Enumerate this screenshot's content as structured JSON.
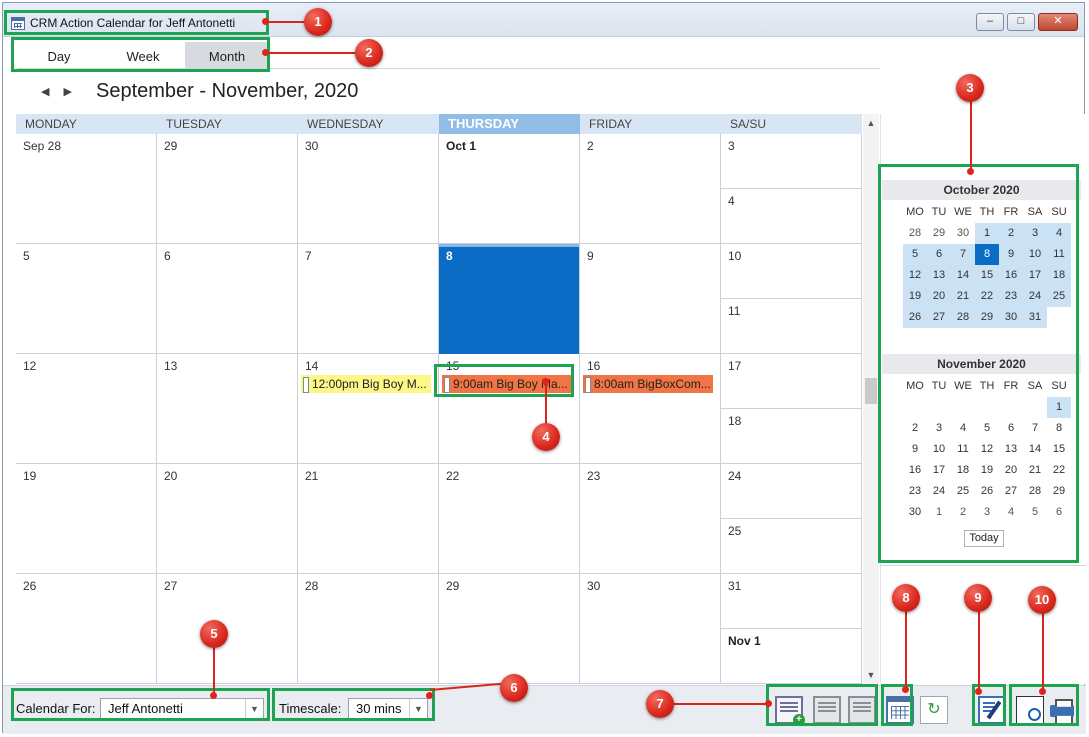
{
  "window": {
    "title": "CRM Action Calendar for Jeff Antonetti",
    "controls": [
      "–",
      "□",
      "✕"
    ]
  },
  "view_tabs": [
    {
      "label": "Day",
      "active": false
    },
    {
      "label": "Week",
      "active": false
    },
    {
      "label": "Month",
      "active": true
    }
  ],
  "range_title": "September - November, 2020",
  "days_header": [
    "MONDAY",
    "TUESDAY",
    "WEDNESDAY",
    "THURSDAY",
    "FRIDAY",
    "SA/SU"
  ],
  "weeks": [
    {
      "days": [
        "Sep 28",
        "29",
        "30",
        "Oct 1",
        "2"
      ],
      "sat": "3",
      "sun": "4"
    },
    {
      "days": [
        "5",
        "6",
        "7",
        "8",
        "9"
      ],
      "sat": "10",
      "sun": "11"
    },
    {
      "days": [
        "12",
        "13",
        "14",
        "15",
        "16"
      ],
      "sat": "17",
      "sun": "18"
    },
    {
      "days": [
        "19",
        "20",
        "21",
        "22",
        "23"
      ],
      "sat": "24",
      "sun": "25"
    },
    {
      "days": [
        "26",
        "27",
        "28",
        "29",
        "30"
      ],
      "sat": "31",
      "sun": "Nov 1"
    }
  ],
  "appointments": [
    {
      "text": "12:00pm Big Boy M...",
      "color": "#fcf888"
    },
    {
      "text": "9:00am Big Boy Ma...",
      "color": "#f07444"
    },
    {
      "text": "8:00am BigBoxCom...",
      "color": "#f07444"
    }
  ],
  "mini_calendar": {
    "dow": [
      "MO",
      "TU",
      "WE",
      "TH",
      "FR",
      "SA",
      "SU"
    ],
    "october": {
      "title": "October 2020",
      "rows": [
        [
          "28",
          "29",
          "30",
          "1",
          "2",
          "3",
          "4"
        ],
        [
          "5",
          "6",
          "7",
          "8",
          "9",
          "10",
          "11"
        ],
        [
          "12",
          "13",
          "14",
          "15",
          "16",
          "17",
          "18"
        ],
        [
          "19",
          "20",
          "21",
          "22",
          "23",
          "24",
          "25"
        ],
        [
          "26",
          "27",
          "28",
          "29",
          "30",
          "31",
          ""
        ]
      ]
    },
    "november": {
      "title": "November 2020",
      "rows": [
        [
          "",
          "",
          "",
          "",
          "",
          "",
          "1"
        ],
        [
          "2",
          "3",
          "4",
          "5",
          "6",
          "7",
          "8"
        ],
        [
          "9",
          "10",
          "11",
          "12",
          "13",
          "14",
          "15"
        ],
        [
          "16",
          "17",
          "18",
          "19",
          "20",
          "21",
          "22"
        ],
        [
          "23",
          "24",
          "25",
          "26",
          "27",
          "28",
          "29"
        ],
        [
          "30",
          "1",
          "2",
          "3",
          "4",
          "5",
          "6"
        ]
      ]
    },
    "today_label": "Today"
  },
  "bottom": {
    "calendar_for_label": "Calendar For:",
    "calendar_for_value": "Jeff Antonetti",
    "timescale_label": "Timescale:",
    "timescale_value": "30 mins"
  },
  "markers": [
    "1",
    "2",
    "3",
    "4",
    "5",
    "6",
    "7",
    "8",
    "9",
    "10"
  ],
  "colors": {
    "callout": "#1da352",
    "marker": "#d9261c",
    "selected_day": "#0a6cc4",
    "today_header": "#8fbde6"
  }
}
